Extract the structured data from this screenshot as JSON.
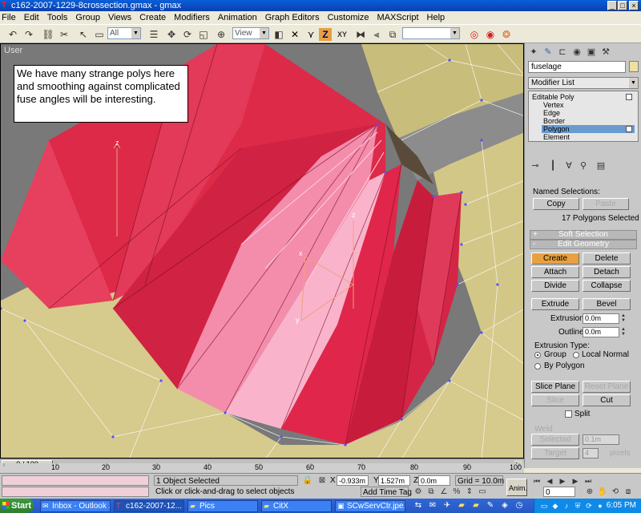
{
  "window": {
    "title": "c162-2007-1229-8crossection.gmax - gmax",
    "minimize": "_",
    "maximize": "□",
    "close": "×"
  },
  "menu": [
    "File",
    "Edit",
    "Tools",
    "Group",
    "Views",
    "Create",
    "Modifiers",
    "Animation",
    "Graph Editors",
    "Customize",
    "MAXScript",
    "Help"
  ],
  "toolbar": {
    "selection_filter": "All",
    "reference_coord": "View",
    "axis_label": "XY",
    "z_label": "Z"
  },
  "viewport": {
    "label": "User",
    "note": "We have many strange polys here and smoothing against complicated fuse angles will be interesting.",
    "axis_z": "z",
    "axis_x": "x",
    "axis_y": "y"
  },
  "command_panel": {
    "object_name": "fuselage",
    "modifier_list": "Modifier List",
    "stack": {
      "base": "Editable Poly",
      "subobjects": [
        "Vertex",
        "Edge",
        "Border",
        "Polygon",
        "Element"
      ],
      "selected": "Polygon"
    },
    "selection": {
      "named_selections": "Named Selections:",
      "copy": "Copy",
      "paste": "Paste",
      "status": "17 Polygons Selected"
    },
    "soft_selection": "Soft Selection",
    "edit_geometry": {
      "header": "Edit Geometry",
      "create": "Create",
      "delete": "Delete",
      "attach": "Attach",
      "detach": "Detach",
      "divide": "Divide",
      "collapse": "Collapse",
      "extrude": "Extrude",
      "bevel": "Bevel",
      "extrusion_label": "Extrusion:",
      "extrusion_value": "0.0m",
      "outline_label": "Outline",
      "outline_value": "0.0m",
      "extrusion_type": "Extrusion Type:",
      "group": "Group",
      "local_normal": "Local Normal",
      "by_polygon": "By Polygon",
      "slice_plane": "Slice Plane",
      "reset_plane": "Reset Plane",
      "slice": "Slice",
      "cut": "Cut",
      "split": "Split",
      "weld": "Weld",
      "selected": "Selected",
      "weld_value": "0.1m",
      "target": "Target",
      "target_value": "4",
      "pixels": "pixels"
    }
  },
  "timeline": {
    "frame": "0 / 100",
    "ticks": [
      "10",
      "20",
      "30",
      "40",
      "50",
      "60",
      "70",
      "80",
      "90",
      "100"
    ]
  },
  "status": {
    "selected": "1 Object Selected",
    "prompt": "Click or click-and-drag to select objects",
    "x_label": "X",
    "x_value": "-0.933m",
    "y_label": "Y",
    "y_value": "1.527m",
    "z_label": "Z",
    "z_value": "0.0m",
    "grid": "Grid = 10.0m",
    "add_time_tag": "Add Time Tag",
    "anim": "Anim.",
    "frame_value": "0"
  },
  "taskbar": {
    "start": "Start",
    "items": [
      "Inbox - Outlook ...",
      "c162-2007-12...",
      "Pics",
      "CitX",
      "SCwServCtr.jpe..."
    ],
    "clock": "6:05 PM"
  },
  "colors": {
    "mesh_red": "#dc2a48",
    "mesh_pink": "#f490b0",
    "ground": "#d8cc8e",
    "accent_button": "#e8a040"
  }
}
